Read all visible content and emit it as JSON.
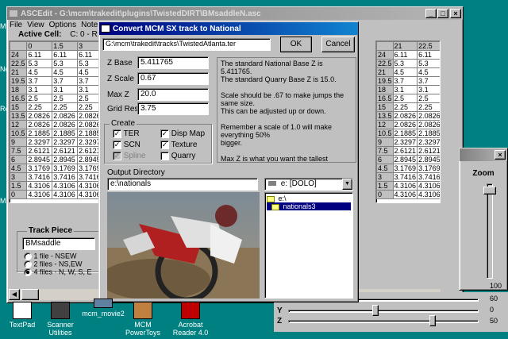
{
  "asce": {
    "title": "ASCEdit - G:\\mcm\\trakedit\\plugins\\TwistedDIRT\\BMsaddleN.asc",
    "menu": [
      "File",
      "View",
      "Options",
      "Notes"
    ],
    "active_cell_label": "Active Cell:",
    "active_cell_value": "C: 0 - R: 24",
    "col_headers_left": [
      "0",
      "1.5",
      "3"
    ],
    "col_headers_right": [
      "21",
      "22.5",
      "24"
    ],
    "rows": [
      {
        "r": "24",
        "v": [
          "6.11",
          "6.11",
          "6.11"
        ],
        "rv": [
          "6.11",
          "6.11",
          "6.11"
        ]
      },
      {
        "r": "22.5",
        "v": [
          "5.3",
          "5.3",
          "5.3"
        ],
        "rv": [
          "5.3",
          "5.3",
          "5.3"
        ]
      },
      {
        "r": "21",
        "v": [
          "4.5",
          "4.5",
          "4.5"
        ],
        "rv": [
          "4.5",
          "4.5",
          "4.5"
        ]
      },
      {
        "r": "19.5",
        "v": [
          "3.7",
          "3.7",
          "3.7"
        ],
        "rv": [
          "3.7",
          "3.7",
          "3.7"
        ]
      },
      {
        "r": "18",
        "v": [
          "3.1",
          "3.1",
          "3.1"
        ],
        "rv": [
          "3.1",
          "3.1",
          "3.1"
        ]
      },
      {
        "r": "16.5",
        "v": [
          "2.5",
          "2.5",
          "2.5"
        ],
        "rv": [
          "2.5",
          "2.5",
          "2.5"
        ]
      },
      {
        "r": "15",
        "v": [
          "2.25",
          "2.25",
          "2.25"
        ],
        "rv": [
          "2.25",
          "2.25",
          "2.25"
        ]
      },
      {
        "r": "13.5",
        "v": [
          "2.0826",
          "2.0826",
          "2.0826"
        ],
        "rv": [
          "2.0826",
          "2.0826",
          "2.0826"
        ]
      },
      {
        "r": "12",
        "v": [
          "2.0826",
          "2.0826",
          "2.0826"
        ],
        "rv": [
          "2.0826",
          "2.0826",
          "2.0826"
        ]
      },
      {
        "r": "10.5",
        "v": [
          "2.1885",
          "2.1885",
          "2.1885"
        ],
        "rv": [
          "2.1885",
          "2.1885",
          "2.1885"
        ]
      },
      {
        "r": "9",
        "v": [
          "2.3297",
          "2.3297",
          "2.3297"
        ],
        "rv": [
          "2.3297",
          "2.3297",
          "2.3297"
        ]
      },
      {
        "r": "7.5",
        "v": [
          "2.6121",
          "2.6121",
          "2.6121"
        ],
        "rv": [
          "2.6121",
          "2.6121",
          "2.6121"
        ]
      },
      {
        "r": "6",
        "v": [
          "2.8945",
          "2.8945",
          "2.8945"
        ],
        "rv": [
          "2.8945",
          "2.8945",
          "2.8945"
        ]
      },
      {
        "r": "4.5",
        "v": [
          "3.1769",
          "3.1769",
          "3.1769"
        ],
        "rv": [
          "3.1769",
          "3.1769",
          "3.1769"
        ]
      },
      {
        "r": "3",
        "v": [
          "3.7416",
          "3.7416",
          "3.7416"
        ],
        "rv": [
          "3.7416",
          "3.7416",
          "3.7416"
        ]
      },
      {
        "r": "1.5",
        "v": [
          "4.3106",
          "4.3106",
          "4.3106"
        ],
        "rv": [
          "4.3106",
          "4.3106",
          "4.3106"
        ]
      },
      {
        "r": "0",
        "v": [
          "4.3106",
          "4.3106",
          "4.3106"
        ],
        "rv": [
          "4.3106",
          "4.3106",
          "4.3106"
        ]
      }
    ],
    "track_piece_label": "Track Piece",
    "track_piece_value": "BMsaddle",
    "radio_options": [
      "1 file - NSEW",
      "2 files - NS,EW",
      "4 files - N, W, S, E"
    ]
  },
  "dialog": {
    "title": "Convert MCM SX track to National",
    "path": "G:\\mcm\\trakedit\\tracks\\TwistedAtlanta.ter",
    "ok_label": "OK",
    "cancel_label": "Cancel",
    "z_base_label": "Z Base",
    "z_base_value": "5.411765",
    "z_scale_label": "Z Scale",
    "z_scale_value": "0.67",
    "max_z_label": "Max Z",
    "max_z_value": "20.0",
    "grid_res_label": "Grid Res:",
    "grid_res_value": "3.75",
    "info_lines": [
      "The standard National Base Z is 5.411765.",
      "The standard Quarry Base Z is 15.0.",
      "",
      "Scale should be .67 to make jumps the same size.",
      "This can be adjusted up or down.",
      "",
      "Remember a scale of 1.0 will make everything 50%",
      "bigger.",
      "",
      "Max Z is what you want the tallest potential Z to",
      "be. It will be adjusted if the track converted is taller."
    ],
    "create_label": "Create",
    "cb_ter": "TER",
    "cb_scn": "SCN",
    "cb_spline": "Spline",
    "cb_dispmap": "Disp Map",
    "cb_texture": "Texture",
    "cb_quarry": "Quarry",
    "output_dir_label": "Output Directory",
    "output_dir_value": "e:\\nationals",
    "drive_value": "e: [DOLO]",
    "dir_items": [
      "e:\\",
      "nationals3"
    ]
  },
  "zoom": {
    "label": "Zoom",
    "value": "100",
    "x_label": "X",
    "y_label": "Y",
    "z_label": "Z",
    "x_value": "60",
    "y_value": "0",
    "z_value": "50"
  },
  "desktop": {
    "icons": [
      "TextPad",
      "Scanner Utilities",
      "mcm_movie2",
      "MCM PowerToys",
      "Acrobat Reader 4.0"
    ],
    "left_edge_labels": [
      "My",
      "Ne",
      "Re",
      "M"
    ]
  },
  "colors": {
    "desktop": "#008080",
    "title_active": "#000080",
    "selection": "#000080"
  }
}
